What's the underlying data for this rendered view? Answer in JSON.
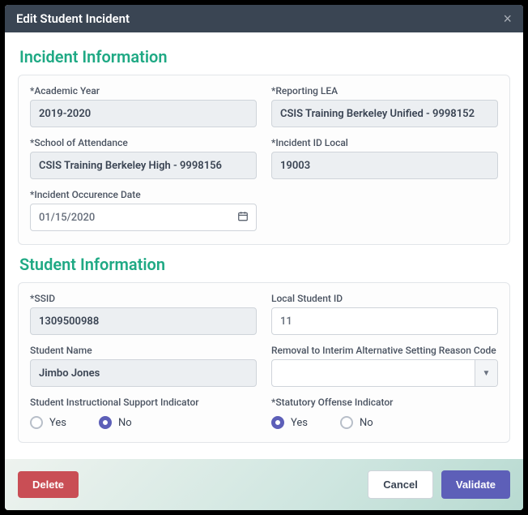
{
  "header": {
    "title": "Edit Student Incident"
  },
  "sections": {
    "incident": {
      "title": "Incident Information",
      "fields": {
        "academic_year": {
          "label": "*Academic Year",
          "value": "2019-2020"
        },
        "reporting_lea": {
          "label": "*Reporting LEA",
          "value": "CSIS Training Berkeley Unified - 9998152"
        },
        "school": {
          "label": "*School of Attendance",
          "value": "CSIS Training Berkeley High - 9998156"
        },
        "incident_id": {
          "label": "*Incident ID Local",
          "value": "19003"
        },
        "occurrence_date": {
          "label": "*Incident Occurence Date",
          "value": "01/15/2020"
        }
      }
    },
    "student": {
      "title": "Student Information",
      "fields": {
        "ssid": {
          "label": "*SSID",
          "value": "1309500988"
        },
        "local_id": {
          "label": "Local Student ID",
          "value": "11"
        },
        "name": {
          "label": "Student Name",
          "value": "Jimbo Jones"
        },
        "removal_code": {
          "label": "Removal to Interim Alternative Setting Reason Code",
          "value": ""
        },
        "support_indicator": {
          "label": "Student Instructional Support Indicator",
          "options": {
            "yes": "Yes",
            "no": "No"
          },
          "selected": "no"
        },
        "offense_indicator": {
          "label": "*Statutory Offense Indicator",
          "options": {
            "yes": "Yes",
            "no": "No"
          },
          "selected": "yes"
        }
      }
    }
  },
  "footer": {
    "delete": "Delete",
    "cancel": "Cancel",
    "validate": "Validate"
  }
}
